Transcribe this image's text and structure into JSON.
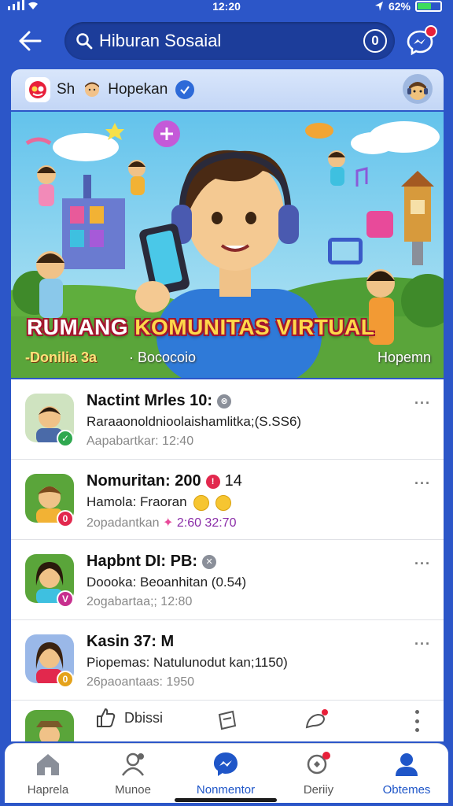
{
  "status_bar": {
    "time": "12:20",
    "battery": "62%",
    "battery_level": 0.62
  },
  "top_bar": {
    "search_text": "Hiburan Sosaial",
    "search_badge": "0"
  },
  "group_header": {
    "short_name": "Sh",
    "name": "Hopekan"
  },
  "banner": {
    "title_part1": "RUMANG ",
    "title_part2": "KOMUNITAS VIRTUAL",
    "sub_left": "-Donilia 3a",
    "sub_mid": "· Bococoio",
    "sub_right": "Hopemn"
  },
  "feed": {
    "items": [
      {
        "title": "Nactint Mrles 10:",
        "line2": "Raraaonoldnioolaishamlitka;(S.SS6)",
        "line3": "Aapabartkar: 12:40",
        "more": "···",
        "badge": "✓",
        "badge_color": "#2fa84f",
        "title_badge_color": "#8a8f99"
      },
      {
        "title": "Nomuritan: 200",
        "title_extra": "14",
        "line2": "Hamola: Fraoran",
        "line3_prefix": "2opadantkan",
        "line3_highlight": "2:60  32:70",
        "more": "···",
        "badge": "0",
        "badge_color": "#e2284d",
        "title_badge_color": "#e2284d"
      },
      {
        "title": "Hapbnt DI: PB:",
        "line2": "Doooka: Beoanhitan (0.54)",
        "line3": "2ogabartaa;; 12:80",
        "more": "···",
        "badge": "V",
        "badge_color": "#c72f8e",
        "title_badge_color": "#8a8f99"
      },
      {
        "title": "Kasin 37: M",
        "line2": "Piopemas: Natulunodut kan;1150)",
        "line3": "26paoantaas: 1950",
        "more": "···",
        "badge": "0",
        "badge_color": "#e4a21b"
      }
    ]
  },
  "actions": {
    "like_label": "Dbissi"
  },
  "bottom_nav": {
    "items": [
      {
        "label": "Haprela"
      },
      {
        "label": "Munoe"
      },
      {
        "label": "Nonmentor"
      },
      {
        "label": "Deriiy"
      },
      {
        "label": "Obtemes"
      }
    ]
  },
  "colors": {
    "brand_blue": "#2c56c8",
    "active_nav": "#1f56c8",
    "notification_red": "#e8203a"
  },
  "icons": [
    "signal-icon",
    "wifi-icon",
    "location-icon",
    "battery-icon",
    "back-arrow-icon",
    "search-icon",
    "messenger-icon",
    "verified-icon",
    "home-icon",
    "people-icon",
    "chat-icon",
    "notifications-icon",
    "profile-icon",
    "like-icon",
    "share-icon",
    "comment-icon",
    "more-vertical-icon"
  ]
}
